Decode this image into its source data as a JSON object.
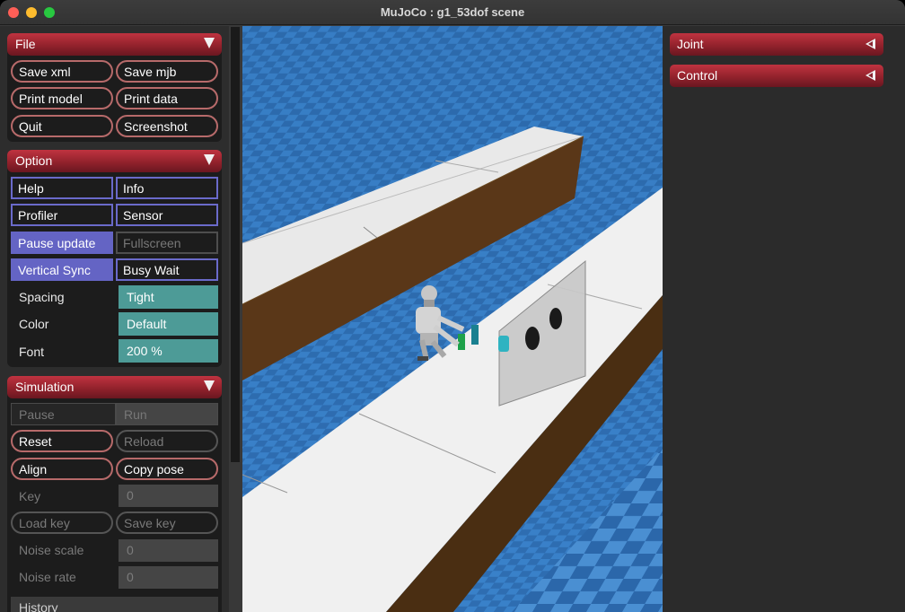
{
  "window": {
    "title": "MuJoCo : g1_53dof scene"
  },
  "file": {
    "header": "File",
    "buttons": [
      "Save xml",
      "Save mjb",
      "Print model",
      "Print data",
      "Quit",
      "Screenshot"
    ]
  },
  "option": {
    "header": "Option",
    "help": "Help",
    "info": "Info",
    "profiler": "Profiler",
    "sensor": "Sensor",
    "pause_update": "Pause update",
    "fullscreen": "Fullscreen",
    "vertical_sync": "Vertical Sync",
    "busy_wait": "Busy Wait",
    "spacing_label": "Spacing",
    "spacing_value": "Tight",
    "color_label": "Color",
    "color_value": "Default",
    "font_label": "Font",
    "font_value": "200 %"
  },
  "simulation": {
    "header": "Simulation",
    "pause": "Pause",
    "run": "Run",
    "reset": "Reset",
    "reload": "Reload",
    "align": "Align",
    "copy_pose": "Copy pose",
    "key_label": "Key",
    "key_value": "0",
    "load_key": "Load key",
    "save_key": "Save key",
    "noise_scale_label": "Noise scale",
    "noise_scale_value": "0",
    "noise_rate_label": "Noise rate",
    "noise_rate_value": "0",
    "history_label": "History"
  },
  "right": {
    "joint": "Joint",
    "control": "Control"
  },
  "colors": {
    "header_red": "#a4283a",
    "toggle_on": "#6464c4",
    "teal": "#4d9b97",
    "floor_blue": "#2a64a8"
  }
}
